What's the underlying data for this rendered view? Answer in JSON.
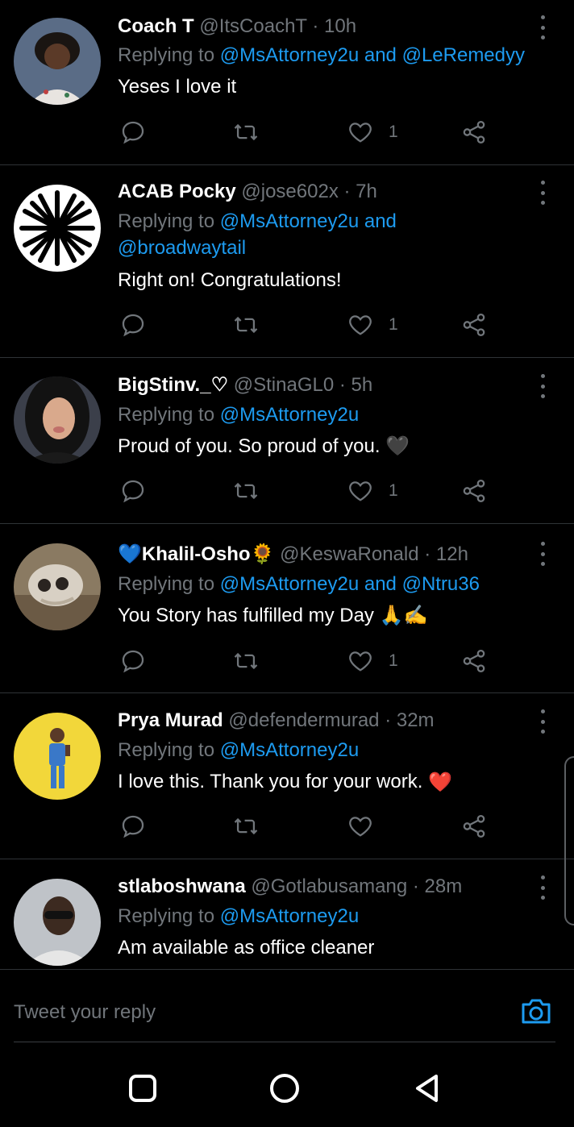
{
  "tweets": [
    {
      "name": "Coach T",
      "handle": "@ItsCoachT",
      "sep": " · ",
      "time": "10h",
      "replying_prefix": "Replying to ",
      "mention_1": "@MsAttorney2u",
      "join": " and ",
      "mention_2": "@LeRemedyy",
      "text": "Yeses I love it",
      "like_count": "1",
      "avatar_icon": "profile-photo-woman"
    },
    {
      "name": "ACAB Pocky",
      "handle": "@jose602x",
      "sep": " · ",
      "time": "7h",
      "replying_prefix": "Replying to ",
      "mention_1": "@MsAttorney2u",
      "join": " and ",
      "mention_2": "@broadwaytail",
      "text": "Right on! Congratulations!",
      "like_count": "1",
      "avatar_icon": "starburst-logo"
    },
    {
      "name": "BigStinv._♡",
      "handle": "@StinaGL0",
      "sep": " · ",
      "time": "5h",
      "replying_prefix": "Replying to ",
      "mention_1": "@MsAttorney2u",
      "text": "Proud of you. So proud of you. 🖤",
      "like_count": "1",
      "avatar_icon": "profile-photo-woman-dark-hair"
    },
    {
      "name_pre": "💙",
      "name": "Khalil-Osho",
      "name_post": "🌻",
      "handle": "@KeswaRonald",
      "sep": " · ",
      "time": "12h",
      "replying_prefix": "Replying to ",
      "mention_1": "@MsAttorney2u",
      "join": " and ",
      "mention_2": "@Ntru36",
      "text": "You Story has fulfilled my Day 🙏✍",
      "like_count": "1",
      "avatar_icon": "skull-photo"
    },
    {
      "name": "Prya Murad",
      "handle": "@defendermurad",
      "sep": " · ",
      "time": "32m",
      "replying_prefix": "Replying to ",
      "mention_1": "@MsAttorney2u",
      "text": "I love this. Thank you for your work.",
      "text_emoji": "❤️",
      "like_count": "",
      "avatar_icon": "illustration-person-yellow"
    },
    {
      "name": "stlaboshwana",
      "handle": "@Gotlabusamang",
      "sep": " · ",
      "time": "28m",
      "replying_prefix": "Replying to ",
      "mention_1": "@MsAttorney2u",
      "text": "Am available as office cleaner",
      "avatar_icon": "profile-photo-man-sunglasses"
    }
  ],
  "composer": {
    "placeholder": "Tweet your reply",
    "camera_icon": "camera-icon"
  },
  "colors": {
    "background": "#000000",
    "accent": "#1d9bf0",
    "muted": "#71767b",
    "divider": "#2f3336"
  },
  "navbar": {
    "icons": [
      "recent-apps-icon",
      "home-icon",
      "back-icon"
    ]
  }
}
